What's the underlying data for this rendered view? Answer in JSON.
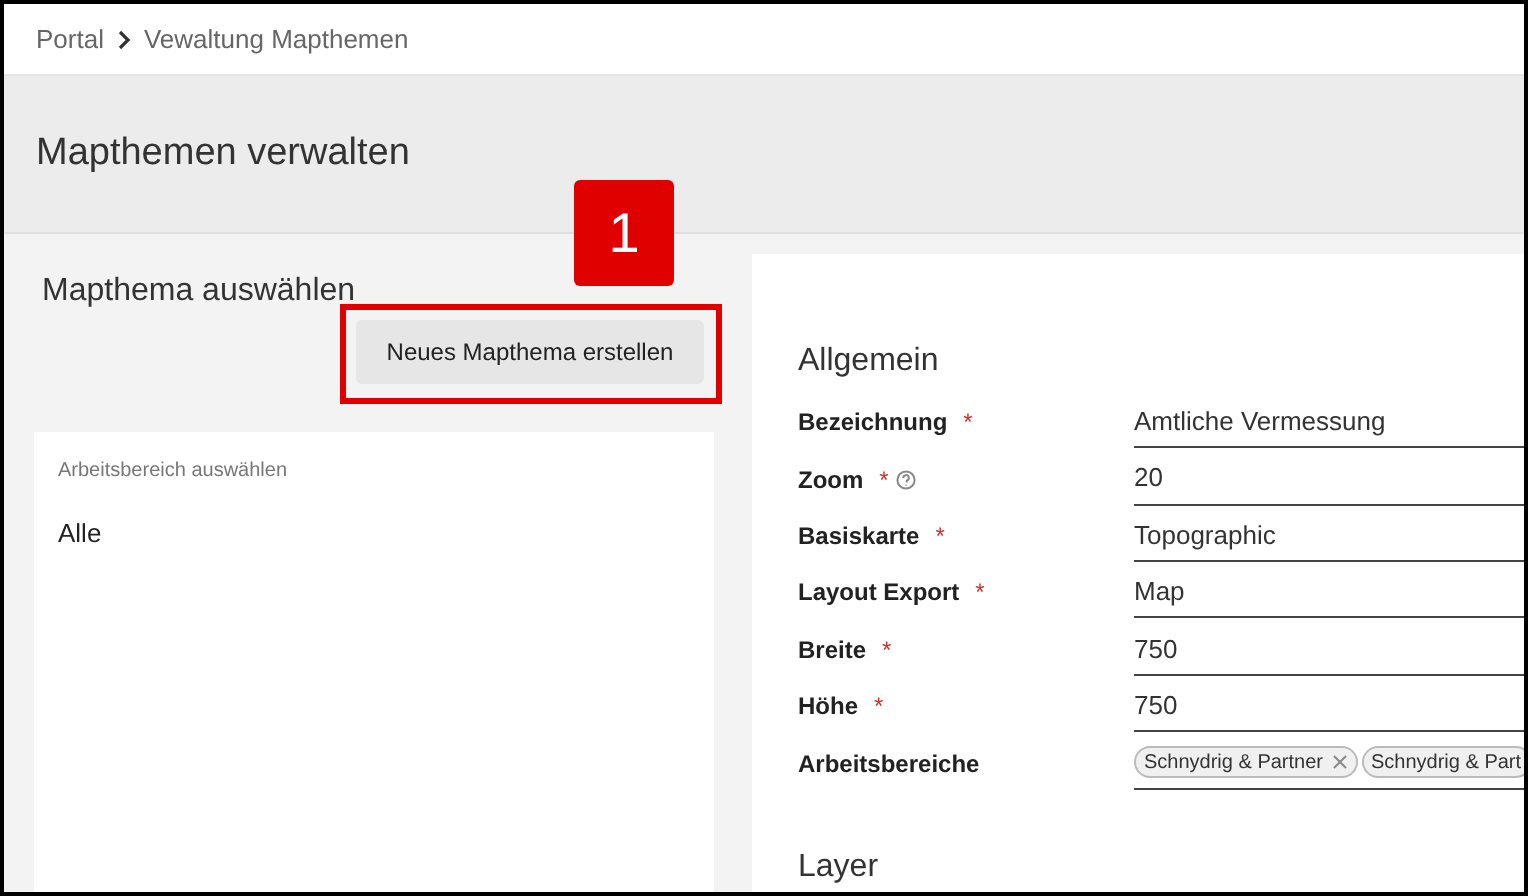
{
  "breadcrumb": [
    "Portal",
    "Vewaltung Mapthemen"
  ],
  "page_title": "Mapthemen verwalten",
  "left": {
    "title": "Mapthema auswählen",
    "new_button": "Neues Mapthema erstellen",
    "callout": "1",
    "workspace_card": {
      "label": "Arbeitsbereich auswählen",
      "items": [
        "Alle"
      ]
    }
  },
  "form": {
    "section": "Allgemein",
    "fields": [
      {
        "kind": "text",
        "label": "Bezeichnung",
        "required_mark": "*",
        "help": false,
        "value": "Amtliche Vermessung"
      },
      {
        "kind": "text",
        "label": "Zoom",
        "required_mark": "*",
        "help": true,
        "value": "20"
      },
      {
        "kind": "text",
        "label": "Basiskarte",
        "required_mark": "*",
        "help": false,
        "value": "Topographic"
      },
      {
        "kind": "text",
        "label": "Layout Export",
        "required_mark": "*",
        "help": false,
        "value": "Map"
      },
      {
        "kind": "text",
        "label": "Breite",
        "required_mark": "*",
        "help": false,
        "value": "750"
      },
      {
        "kind": "text",
        "label": "Höhe",
        "required_mark": "*",
        "help": false,
        "value": "750"
      },
      {
        "kind": "chips",
        "label": "Arbeitsbereiche",
        "help": false,
        "chips": [
          {
            "text": "Schnydrig & Partner",
            "removable": true
          },
          {
            "text": "Schnydrig & Part",
            "removable": false
          }
        ]
      }
    ],
    "next_section": "Layer"
  }
}
